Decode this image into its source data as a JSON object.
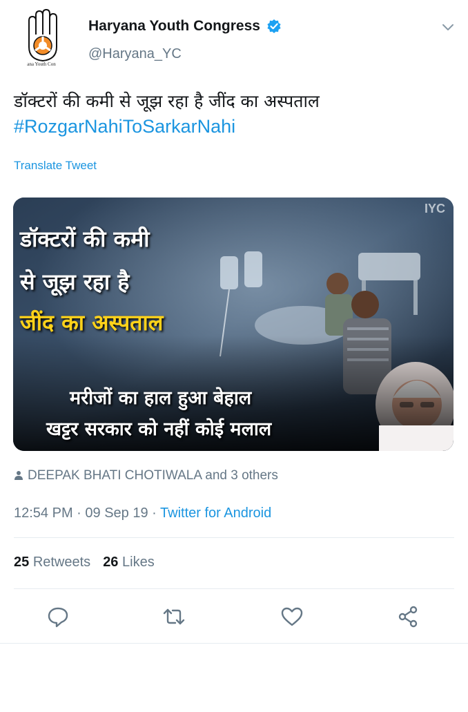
{
  "author": {
    "name": "Haryana Youth Congress",
    "handle": "@Haryana_YC",
    "verified": true,
    "avatar_caption": "ana Youth Con"
  },
  "tweet": {
    "text": "डॉक्टरों की कमी से जूझ रहा है जींद का अस्पताल",
    "hashtag": "#RozgarNahiToSarkarNahi",
    "translate_label": "Translate Tweet"
  },
  "media": {
    "watermark": "IYC",
    "headline_1": "डॉक्टरों की कमी",
    "headline_2": "से जूझ रहा है",
    "headline_3": "जींद का अस्पताल",
    "subline_1": "मरीजों का हाल हुआ बेहाल",
    "subline_2": "खट्टर सरकार को नहीं कोई मलाल"
  },
  "context": {
    "liked_by": "DEEPAK BHATI CHOTIWALA and 3 others"
  },
  "meta": {
    "time": "12:54 PM",
    "date": "09 Sep 19",
    "sep": " · ",
    "source": "Twitter for Android"
  },
  "stats": {
    "retweets_count": "25",
    "retweets_label": "Retweets",
    "likes_count": "26",
    "likes_label": "Likes"
  },
  "actions": [
    "reply-icon",
    "retweet-icon",
    "like-icon",
    "share-icon"
  ],
  "colors": {
    "link": "#1b95e0",
    "secondary": "#657786",
    "divider": "#e6ecf0",
    "headline_yellow": "#ffd21a"
  }
}
